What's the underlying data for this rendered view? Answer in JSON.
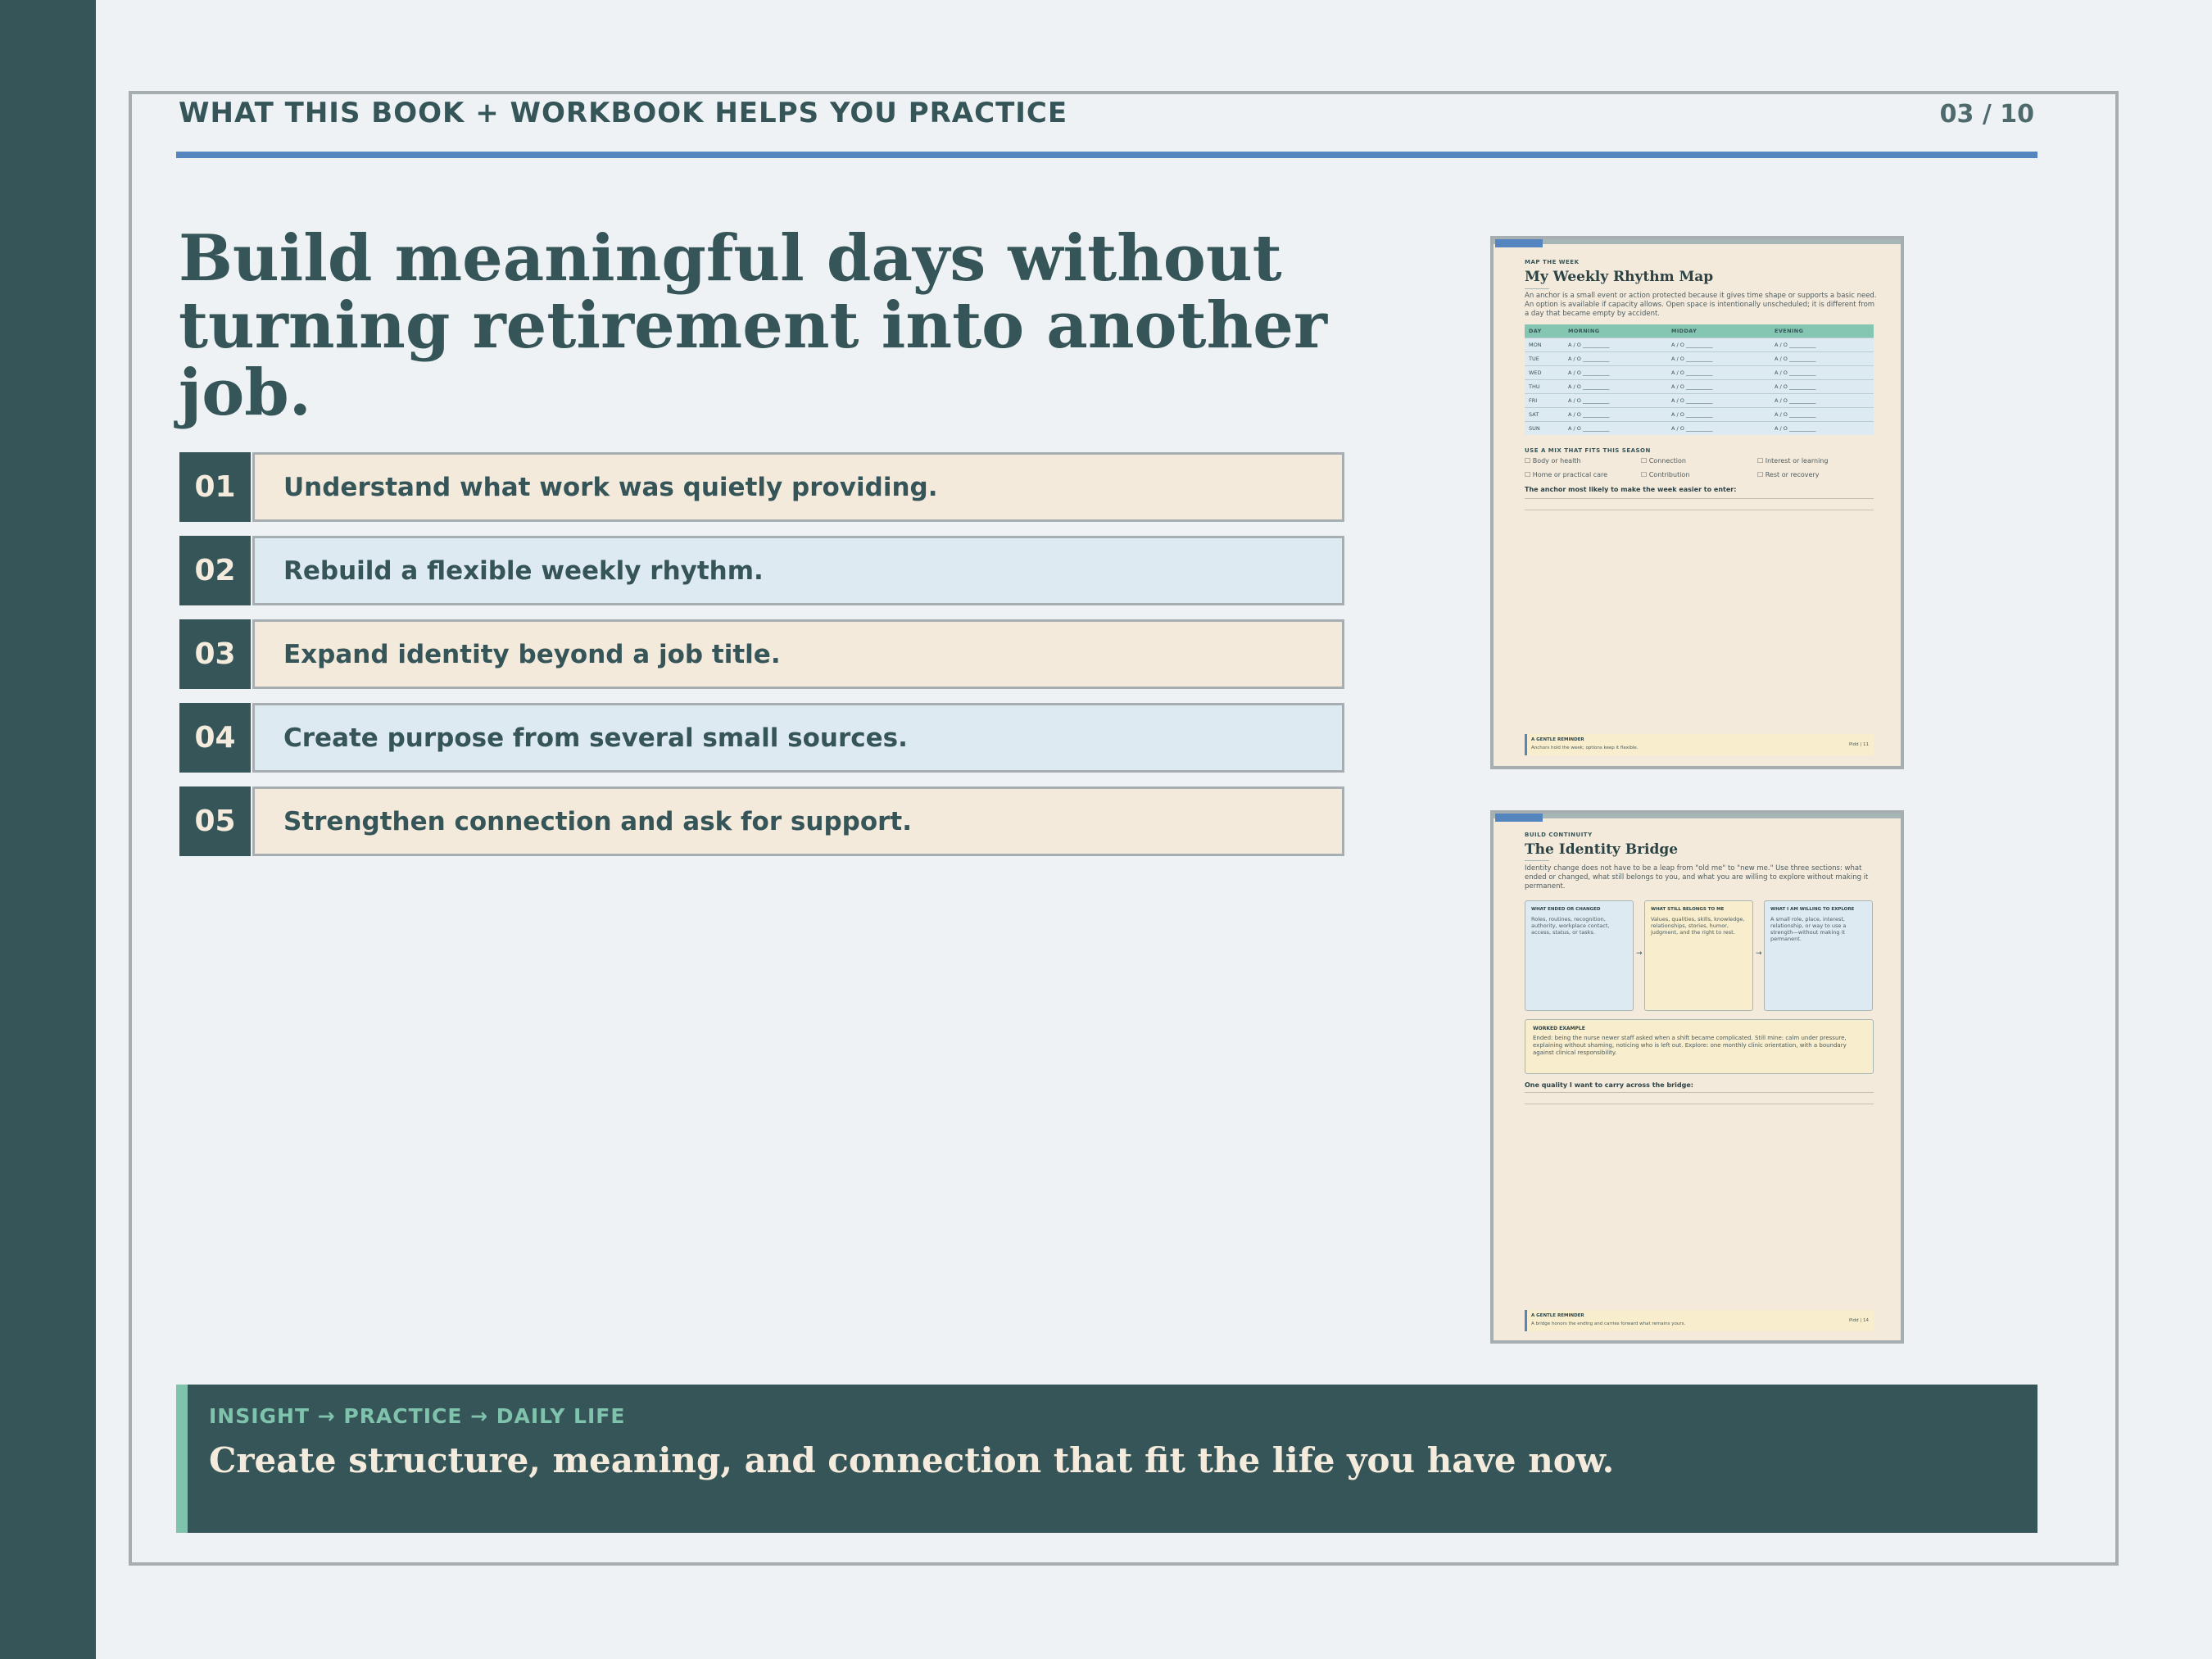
{
  "header": {
    "kicker": "WHAT THIS BOOK + WORKBOOK HELPS YOU PRACTICE",
    "page_number": "03 / 10"
  },
  "headline": "Build meaningful days without turning retirement into another job.",
  "practices": [
    {
      "number": "01",
      "text": "Understand what work was quietly providing."
    },
    {
      "number": "02",
      "text": "Rebuild a flexible weekly rhythm."
    },
    {
      "number": "03",
      "text": "Expand identity beyond a job title."
    },
    {
      "number": "04",
      "text": "Create purpose from several small sources."
    },
    {
      "number": "05",
      "text": "Strengthen connection and ask for support."
    }
  ],
  "workbook_rhythm": {
    "kicker": "MAP THE WEEK",
    "title": "My Weekly Rhythm Map",
    "intro": "An anchor is a small event or action protected because it gives time shape or supports a basic need. An option is available if capacity allows. Open space is intentionally unscheduled; it is different from a day that became empty by accident.",
    "columns": [
      "DAY",
      "MORNING",
      "MIDDAY",
      "EVENING"
    ],
    "days": [
      "MON",
      "TUE",
      "WED",
      "THU",
      "FRI",
      "SAT",
      "SUN"
    ],
    "cell": "A / O __________",
    "mix_label": "USE A MIX THAT FITS THIS SEASON",
    "checklist": [
      "Body or health",
      "Connection",
      "Interest or learning",
      "Home or practical care",
      "Contribution",
      "Rest or recovery"
    ],
    "prompt": "The anchor most likely to make the week easier to enter:",
    "reminder_title": "A GENTLE REMINDER",
    "reminder_text": "Anchors hold the week; options keep it flexible.",
    "footer": "Pidd | 11"
  },
  "workbook_identity": {
    "kicker": "BUILD CONTINUITY",
    "title": "The Identity Bridge",
    "intro": "Identity change does not have to be a leap from \"old me\" to \"new me.\" Use three sections: what ended or changed, what still belongs to you, and what you are willing to explore without making it permanent.",
    "columns": [
      {
        "title": "WHAT ENDED OR CHANGED",
        "body": "Roles, routines, recognition, authority, workplace contact, access, status, or tasks."
      },
      {
        "title": "WHAT STILL BELONGS TO ME",
        "body": "Values, qualities, skills, knowledge, relationships, stories, humor, judgment, and the right to rest."
      },
      {
        "title": "WHAT I AM WILLING TO EXPLORE",
        "body": "A small role, place, interest, relationship, or way to use a strength—without making it permanent."
      }
    ],
    "arrow": "→",
    "worked_title": "WORKED EXAMPLE",
    "worked_text": "Ended: being the nurse newer staff asked when a shift became complicated. Still mine: calm under pressure, explaining without shaming, noticing who is left out. Explore: one monthly clinic orientation, with a boundary against clinical responsibility.",
    "prompt": "One quality I want to carry across the bridge:",
    "reminder_title": "A GENTLE REMINDER",
    "reminder_text": "A bridge honors the ending and carries forward what remains yours.",
    "footer": "Pidd | 14"
  },
  "banner": {
    "kicker": "INSIGHT → PRACTICE → DAILY LIFE",
    "text": "Create structure, meaning, and connection that fit the life you have now."
  },
  "colors": {
    "primary": "#365558",
    "accent_blue": "#5585bf",
    "accent_teal": "#7fc3ad",
    "beige": "#f4eadc",
    "light_blue": "#deeaf2",
    "background": "#eef2f5"
  }
}
